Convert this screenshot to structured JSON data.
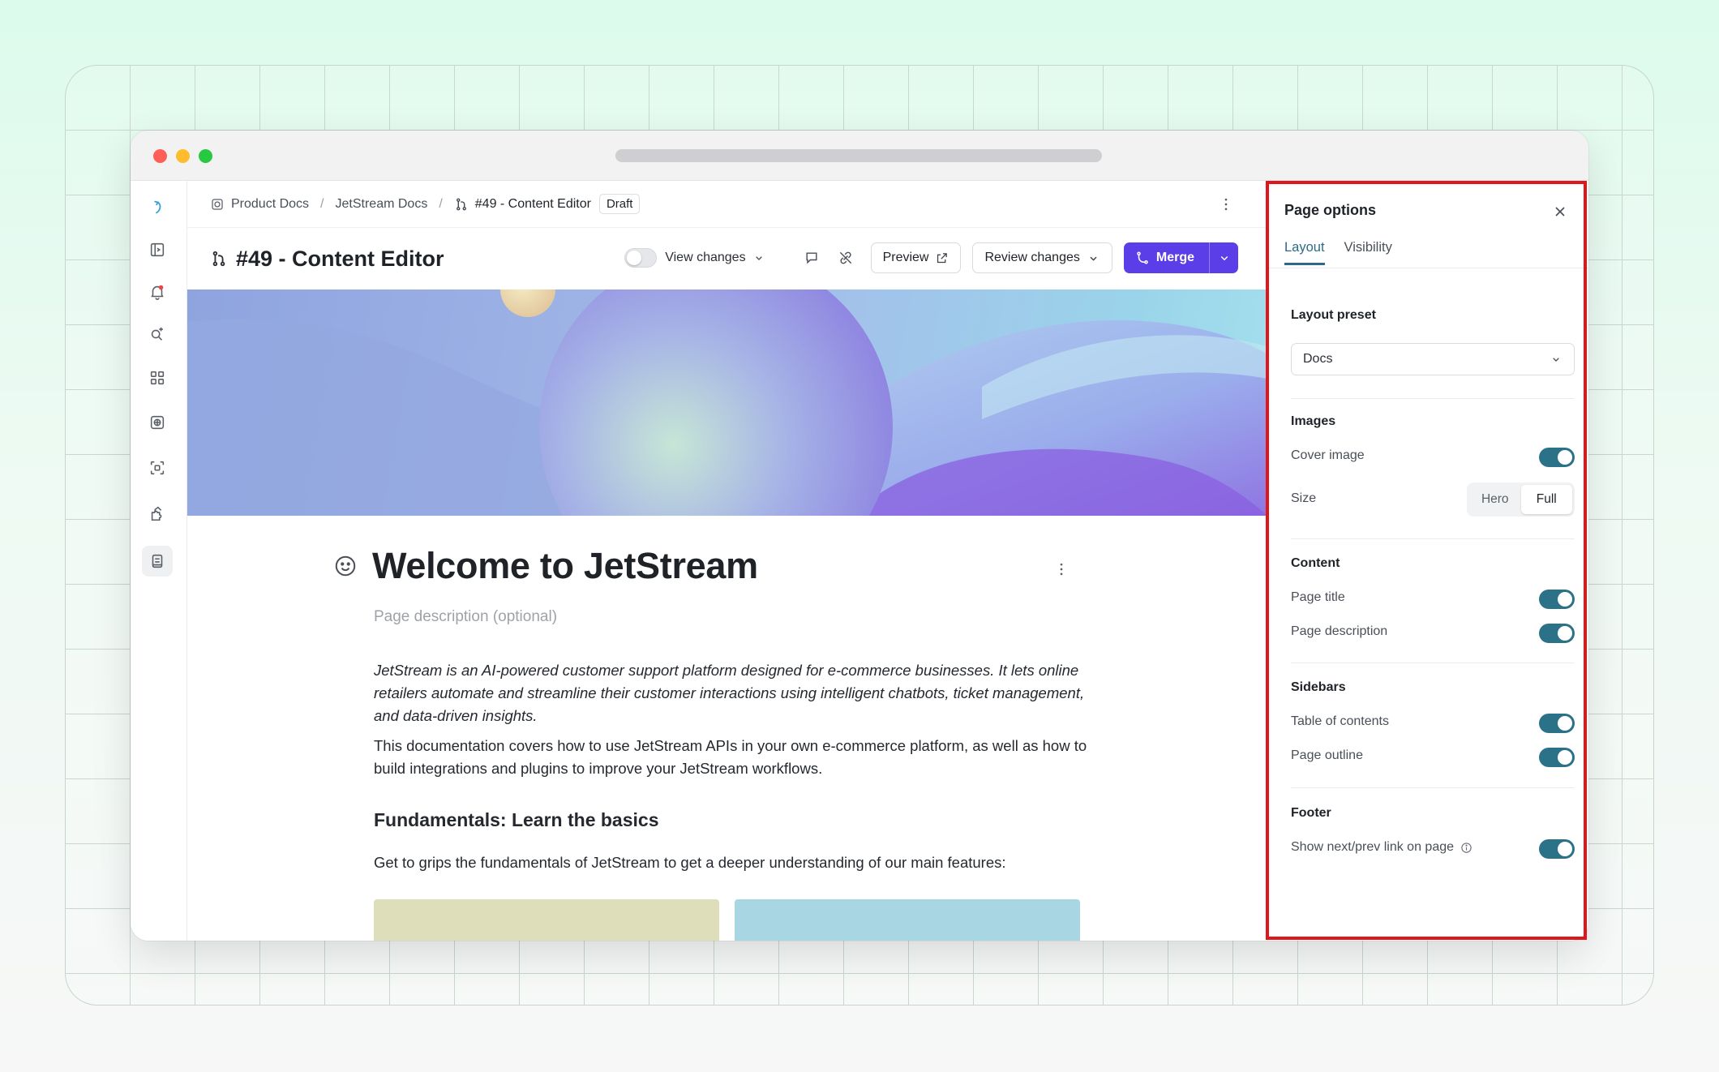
{
  "breadcrumb": {
    "items": [
      "Product Docs",
      "JetStream Docs",
      "#49 - Content Editor"
    ],
    "separator": "/",
    "badge": "Draft"
  },
  "header": {
    "title": "#49 - Content Editor",
    "view_changes_label": "View changes",
    "preview_label": "Preview",
    "review_label": "Review changes",
    "merge_label": "Merge"
  },
  "document": {
    "title": "Welcome to JetStream",
    "description_placeholder": "Page description (optional)",
    "intro_italic": "JetStream is an AI-powered customer support platform designed for e-commerce businesses. It lets online retailers automate and streamline their customer interactions using intelligent chatbots, ticket management, and data-driven insights.",
    "intro": "This documentation covers how to use JetStream APIs in your own e-commerce platform, as well as how to build integrations and plugins to improve your JetStream workflows.",
    "heading": "Fundamentals: Learn the basics",
    "heading_body": "Get to grips the fundamentals of JetStream to get a deeper understanding of our main features:"
  },
  "panel": {
    "title": "Page options",
    "tabs": [
      "Layout",
      "Visibility"
    ],
    "active_tab": "Layout",
    "layout_preset": {
      "label": "Layout preset",
      "value": "Docs"
    },
    "images": {
      "label": "Images",
      "cover_image": {
        "label": "Cover image",
        "on": true
      },
      "size": {
        "label": "Size",
        "options": [
          "Hero",
          "Full"
        ],
        "selected": "Full"
      }
    },
    "content": {
      "label": "Content",
      "page_title": {
        "label": "Page title",
        "on": true
      },
      "page_description": {
        "label": "Page description",
        "on": true
      }
    },
    "sidebars": {
      "label": "Sidebars",
      "toc": {
        "label": "Table of contents",
        "on": true
      },
      "outline": {
        "label": "Page outline",
        "on": true
      }
    },
    "footer": {
      "label": "Footer",
      "next_prev": {
        "label": "Show next/prev link on page",
        "on": true
      }
    }
  },
  "colors": {
    "accent": "#5b3ee8",
    "toggle_on": "#2b7187",
    "highlight": "#e0161d"
  },
  "icons": [
    "logo-icon",
    "sidebar-toggle-icon",
    "bell-icon",
    "search-sparkle-icon",
    "apps-icon",
    "space-icon",
    "scan-icon",
    "puzzle-icon",
    "book-icon",
    "comment-icon",
    "link-off-icon",
    "external-link-icon",
    "branch-icon",
    "smiley-icon",
    "close-icon",
    "info-icon",
    "chevron-down-icon",
    "kebab-icon"
  ]
}
